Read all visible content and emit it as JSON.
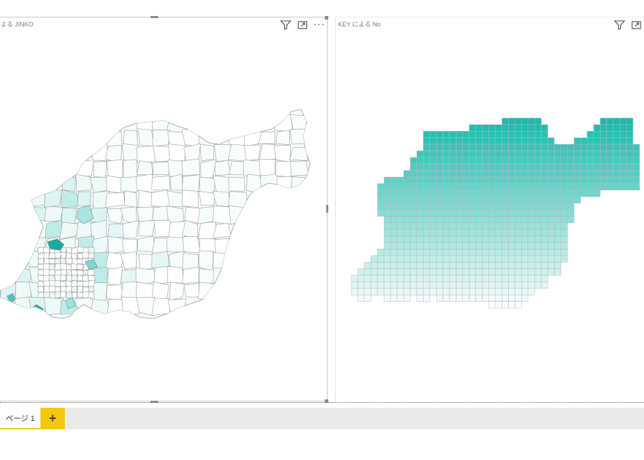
{
  "visuals": {
    "left": {
      "title": "よる JINKO"
    },
    "right": {
      "title": "KEY による No"
    }
  },
  "icons": {
    "filter": "filter-icon",
    "focus": "focus-mode-icon",
    "more": "more-options-icon",
    "add": "plus-icon"
  },
  "colors": {
    "accent_teal": "#14b8a6",
    "tab_accent": "#f2c811",
    "border": "#c8c8c8",
    "map_stroke": "#9a9a9a",
    "grid_stroke": "#b9b9b9"
  },
  "tabs": {
    "pages": [
      {
        "label": "ページ 1"
      }
    ],
    "add_label": "+"
  }
}
